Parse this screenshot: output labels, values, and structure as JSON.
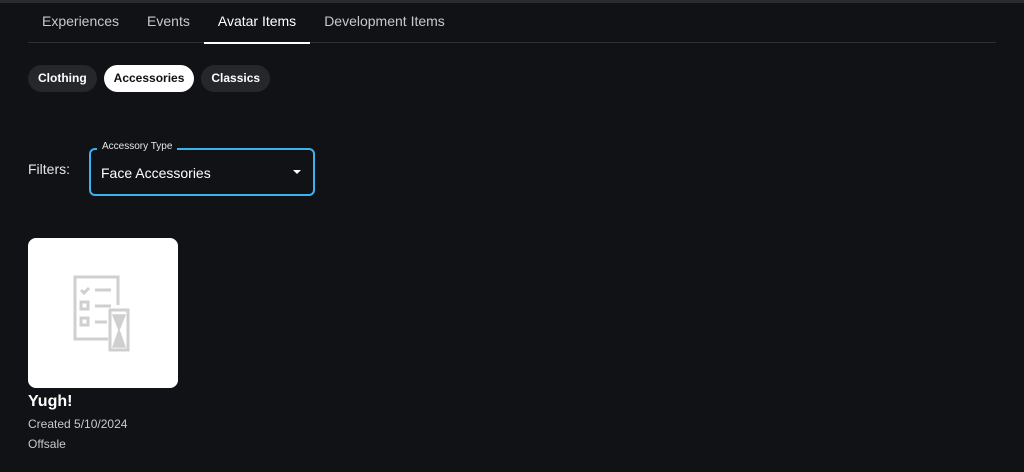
{
  "tabs": [
    {
      "label": "Experiences"
    },
    {
      "label": "Events"
    },
    {
      "label": "Avatar Items",
      "active": true
    },
    {
      "label": "Development Items"
    }
  ],
  "chips": [
    {
      "label": "Clothing"
    },
    {
      "label": "Accessories",
      "active": true
    },
    {
      "label": "Classics"
    }
  ],
  "filters": {
    "label": "Filters:",
    "accessory_type": {
      "legend": "Accessory Type",
      "value": "Face Accessories"
    }
  },
  "items": [
    {
      "name": "Yugh!",
      "created": "Created 5/10/2024",
      "status": "Offsale",
      "icon": "pending-checklist-icon"
    }
  ]
}
